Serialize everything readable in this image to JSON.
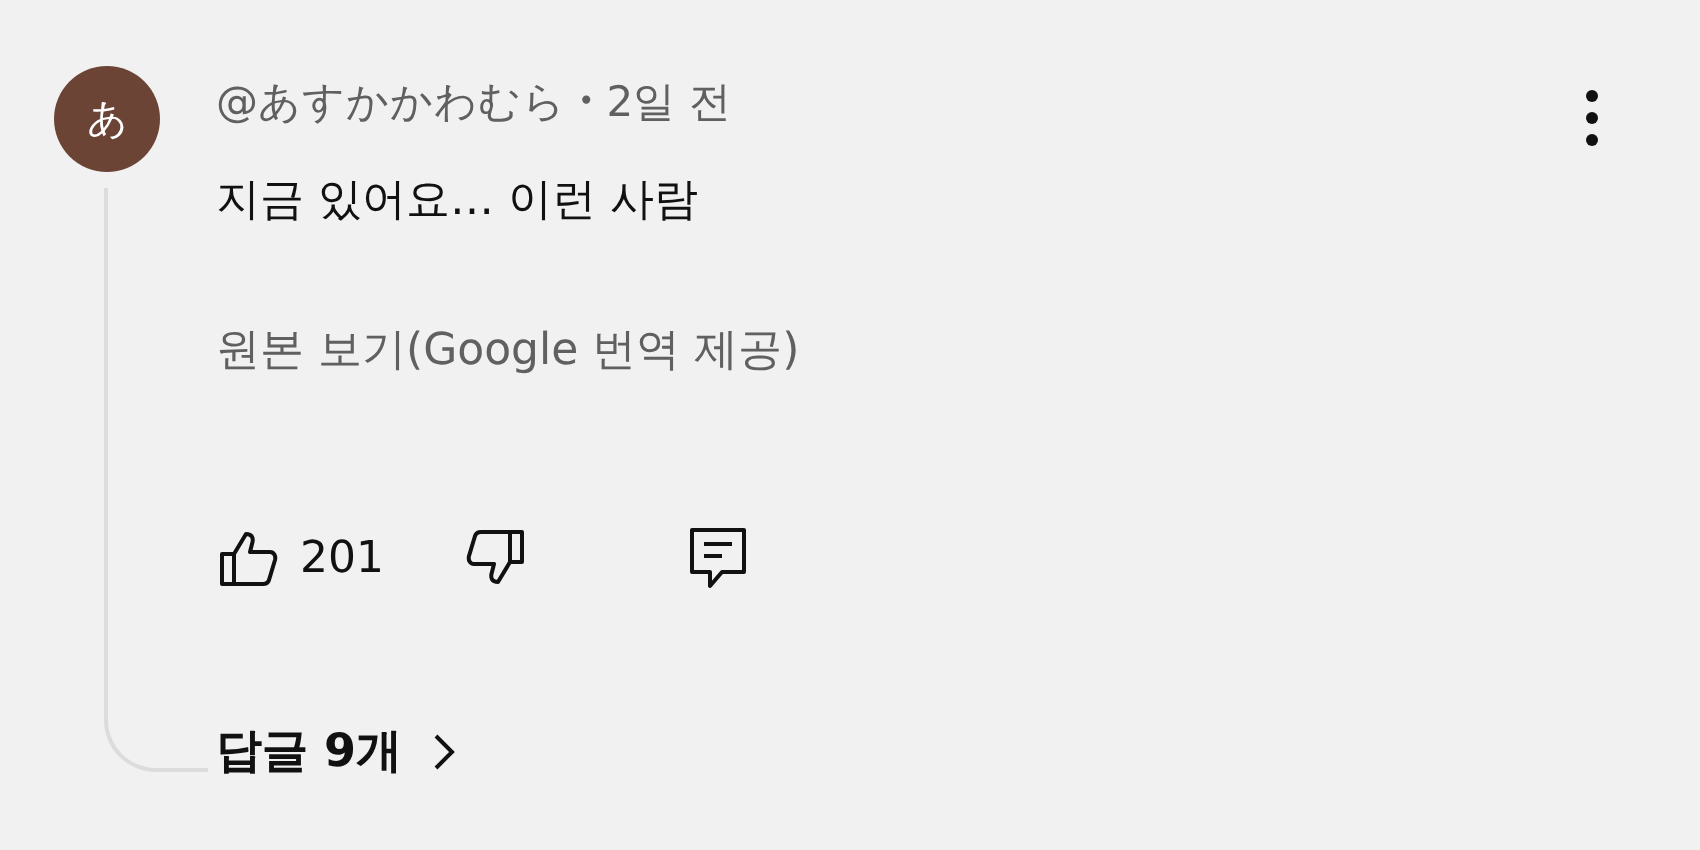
{
  "comment": {
    "avatar": "あ",
    "author": "@あすかかわむら",
    "separator": "•",
    "time": "2일 전",
    "text": "지금 있어요… 이런 사람",
    "translate_link": "원본 보기(Google 번역 제공)",
    "likes": "201"
  },
  "replies": {
    "label": "답글 9개"
  }
}
